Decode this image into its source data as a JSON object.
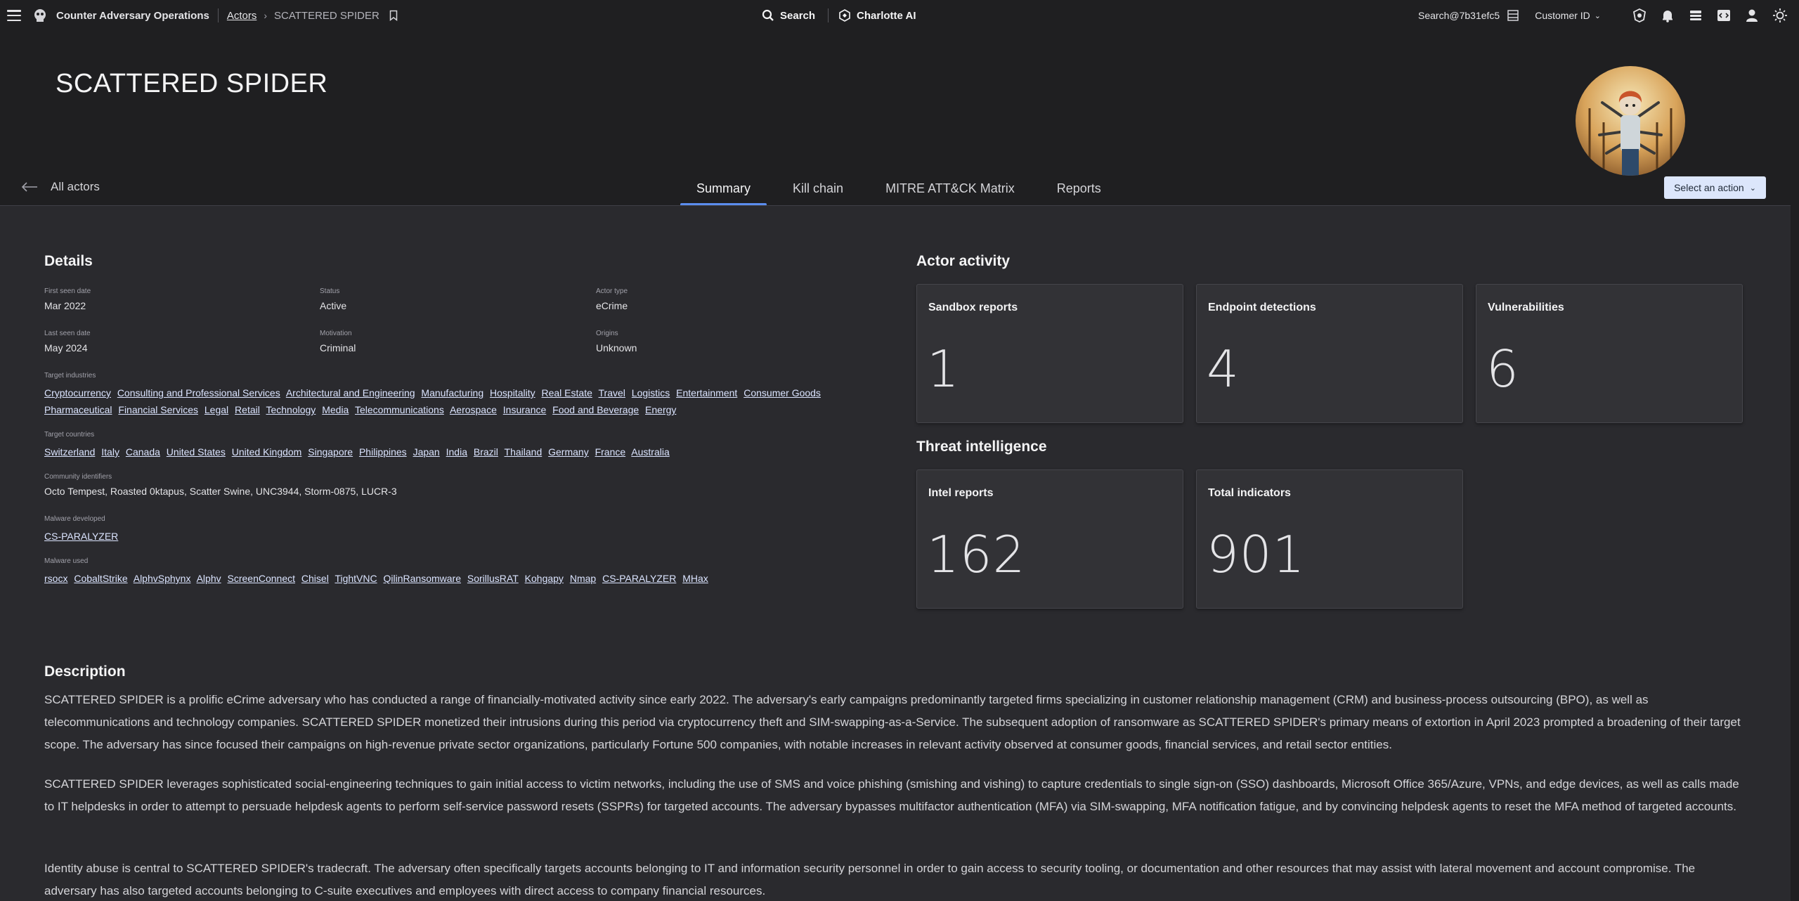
{
  "topbar": {
    "app_name": "Counter Adversary Operations",
    "breadcrumb_link": "Actors",
    "breadcrumb_current": "SCATTERED SPIDER",
    "search_label": "Search",
    "charlotte_label": "Charlotte AI",
    "search_id": "Search@7b31efc5",
    "customer_id_label": "Customer ID"
  },
  "header": {
    "title": "SCATTERED SPIDER",
    "back_label": "All actors",
    "tabs": [
      "Summary",
      "Kill chain",
      "MITRE ATT&CK Matrix",
      "Reports"
    ],
    "action_label": "Select an action"
  },
  "details": {
    "title": "Details",
    "first_seen_label": "First seen date",
    "first_seen": "Mar 2022",
    "status_label": "Status",
    "status": "Active",
    "actor_type_label": "Actor type",
    "actor_type": "eCrime",
    "last_seen_label": "Last seen date",
    "last_seen": "May 2024",
    "motivation_label": "Motivation",
    "motivation": "Criminal",
    "origins_label": "Origins",
    "origins": "Unknown",
    "industries_label": "Target industries",
    "industries": [
      "Cryptocurrency",
      "Consulting and Professional Services",
      "Architectural and Engineering",
      "Manufacturing",
      "Hospitality",
      "Real Estate",
      "Travel",
      "Logistics",
      "Entertainment",
      "Consumer Goods",
      "Pharmaceutical",
      "Financial Services",
      "Legal",
      "Retail",
      "Technology",
      "Media",
      "Telecommunications",
      "Aerospace",
      "Insurance",
      "Food and Beverage",
      "Energy"
    ],
    "countries_label": "Target countries",
    "countries": [
      "Switzerland",
      "Italy",
      "Canada",
      "United States",
      "United Kingdom",
      "Singapore",
      "Philippines",
      "Japan",
      "India",
      "Brazil",
      "Thailand",
      "Germany",
      "France",
      "Australia"
    ],
    "community_label": "Community identifiers",
    "community": "Octo Tempest, Roasted 0ktapus, Scatter Swine, UNC3944, Storm-0875, LUCR-3",
    "malware_dev_label": "Malware developed",
    "malware_dev": [
      "CS-PARALYZER"
    ],
    "malware_used_label": "Malware used",
    "malware_used": [
      "rsocx",
      "CobaltStrike",
      "AlphvSphynx",
      "Alphv",
      "ScreenConnect",
      "Chisel",
      "TightVNC",
      "QilinRansomware",
      "SorillusRAT",
      "Kohgapy",
      "Nmap",
      "CS-PARALYZER",
      "MHax"
    ]
  },
  "activity": {
    "title": "Actor activity",
    "cards": [
      {
        "label": "Sandbox reports",
        "value": "1"
      },
      {
        "label": "Endpoint detections",
        "value": "4"
      },
      {
        "label": "Vulnerabilities",
        "value": "6"
      }
    ]
  },
  "intel": {
    "title": "Threat intelligence",
    "cards": [
      {
        "label": "Intel reports",
        "value": "162"
      },
      {
        "label": "Total indicators",
        "value": "901"
      }
    ]
  },
  "description": {
    "title": "Description",
    "paragraphs": [
      "SCATTERED SPIDER is a prolific eCrime adversary who has conducted a range of financially-motivated activity since early 2022. The adversary's early campaigns predominantly targeted firms specializing in customer relationship management (CRM) and business-process outsourcing (BPO), as well as telecommunications and technology companies. SCATTERED SPIDER monetized their intrusions during this period via cryptocurrency theft and SIM-swapping-as-a-Service. The subsequent adoption of ransomware as SCATTERED SPIDER's primary means of extortion in April 2023 prompted a broadening of their target scope. The adversary has since focused their campaigns on high-revenue private sector organizations, particularly Fortune 500 companies, with notable increases in relevant activity observed at consumer goods, financial services, and retail sector entities.",
      "SCATTERED SPIDER leverages sophisticated social-engineering techniques to gain initial access to victim networks, including the use of SMS and voice phishing (smishing and vishing) to capture credentials to single sign-on (SSO) dashboards, Microsoft Office 365/Azure, VPNs, and edge devices, as well as calls made to IT helpdesks in order to attempt to persuade helpdesk agents to perform self-service password resets (SSPRs) for targeted accounts. The adversary bypasses multifactor authentication (MFA) via SIM-swapping, MFA notification fatigue, and by convincing helpdesk agents to reset the MFA method of targeted accounts.",
      "Identity abuse is central to SCATTERED SPIDER's tradecraft. The adversary often specifically targets accounts belonging to IT and information security personnel in order to gain access to security tooling, or documentation and other resources that may assist with lateral movement and account compromise. The adversary has also targeted accounts belonging to C-suite executives and employees with direct access to company financial resources."
    ]
  }
}
